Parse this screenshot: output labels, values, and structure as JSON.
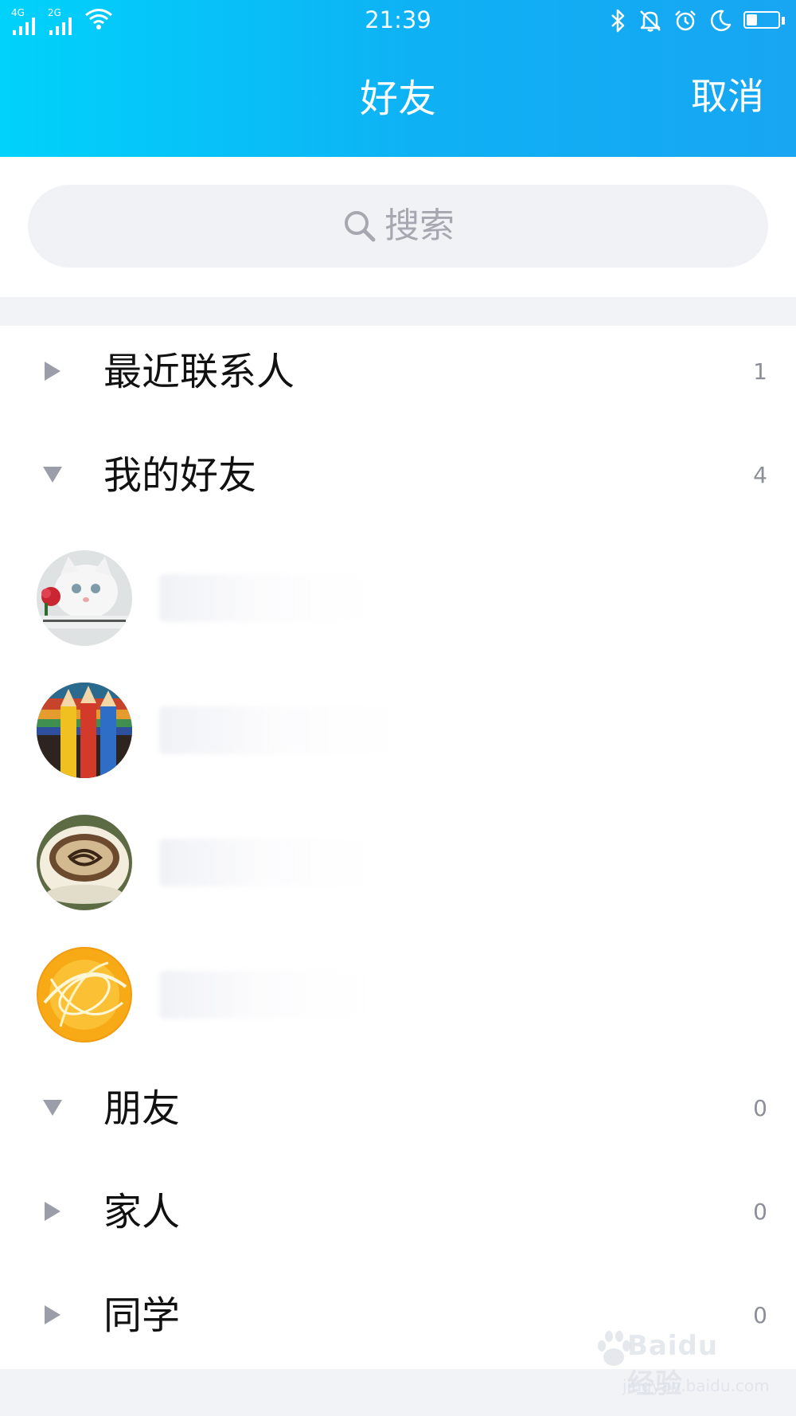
{
  "status_bar": {
    "time": "21:39",
    "network_1": "4G",
    "network_2": "2G",
    "battery_level": 0.35,
    "icons": [
      "signal-icon",
      "wifi-icon",
      "bluetooth-icon",
      "mute-bell-icon",
      "alarm-icon",
      "do-not-disturb-moon-icon",
      "battery-icon"
    ]
  },
  "header": {
    "title": "好友",
    "cancel_label": "取消"
  },
  "search": {
    "placeholder": "搜索",
    "icon": "search-icon"
  },
  "groups": [
    {
      "label": "最近联系人",
      "count": "1",
      "expanded": false
    },
    {
      "label": "我的好友",
      "count": "4",
      "expanded": true
    },
    {
      "label": "朋友",
      "count": "0",
      "expanded": true
    },
    {
      "label": "家人",
      "count": "0",
      "expanded": false
    },
    {
      "label": "同学",
      "count": "0",
      "expanded": false
    }
  ],
  "friends": [
    {
      "avatar": "white-kitten-avatar"
    },
    {
      "avatar": "colored-pencils-avatar"
    },
    {
      "avatar": "coffee-cup-avatar"
    },
    {
      "avatar": "orange-abstract-avatar"
    }
  ],
  "watermark": {
    "main": "Baidu 经验",
    "sub": "jingyan.baidu.com"
  },
  "colors": {
    "header_start": "#00d2fb",
    "header_end": "#18a6f2",
    "background": "#f2f3f7",
    "search_fill": "#f1f2f6",
    "muted_text": "#8c8f98"
  }
}
